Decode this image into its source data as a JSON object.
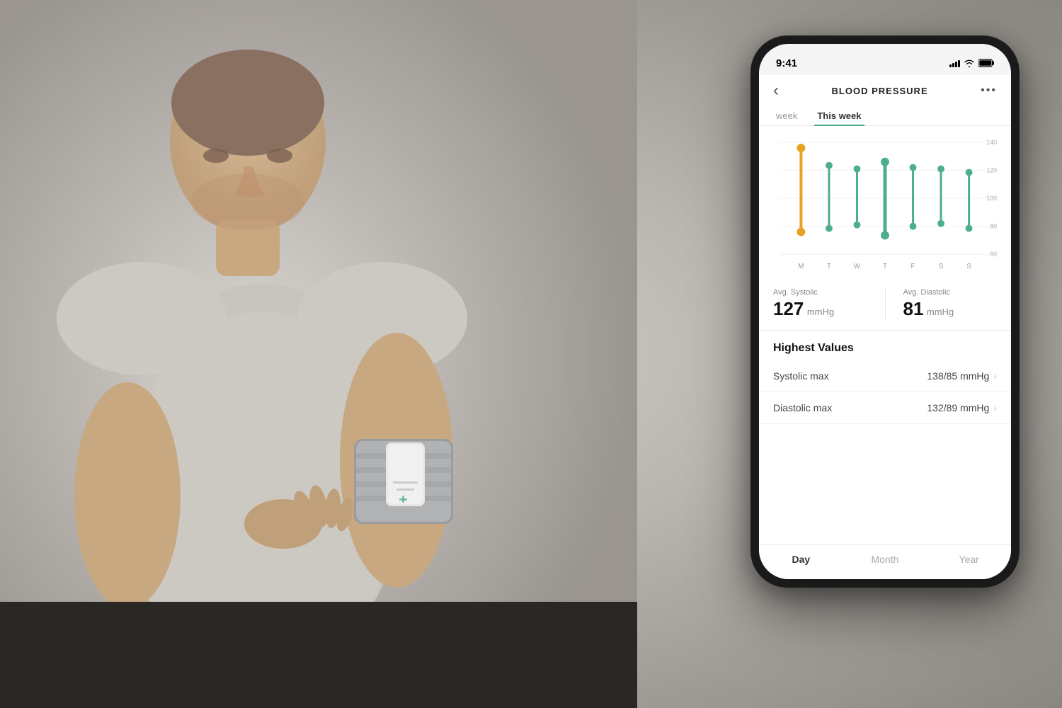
{
  "background": {
    "alt": "Man using blood pressure monitor on arm"
  },
  "phone": {
    "status_bar": {
      "time": "9:41",
      "signal": "signal",
      "wifi": "wifi",
      "battery": "battery"
    },
    "nav": {
      "back_icon": "‹",
      "title": "BLOOD PRESSURE",
      "menu_icon": "•••"
    },
    "tabs": [
      {
        "label": "week",
        "active": false
      },
      {
        "label": "This week",
        "active": true
      }
    ],
    "chart": {
      "y_labels": [
        "140",
        "120",
        "100",
        "80",
        "60"
      ],
      "x_labels": [
        "M",
        "T",
        "W",
        "T",
        "F",
        "S",
        "S"
      ]
    },
    "stats": {
      "systolic": {
        "label": "Avg. Systolic",
        "value": "127",
        "unit": "mmHg"
      },
      "diastolic": {
        "label": "Avg. Diastolic",
        "value": "81",
        "unit": "mmHg"
      }
    },
    "highest_values": {
      "section_title": "Highest Values",
      "rows": [
        {
          "label": "Systolic max",
          "value": "138/85 mmHg",
          "chevron": "›"
        },
        {
          "label": "Diastolic max",
          "value": "132/89 mmHg",
          "chevron": "›"
        }
      ]
    },
    "bottom_tabs": [
      {
        "label": "Day",
        "active": true
      },
      {
        "label": "Month",
        "active": false
      },
      {
        "label": "Year",
        "active": false
      }
    ]
  }
}
